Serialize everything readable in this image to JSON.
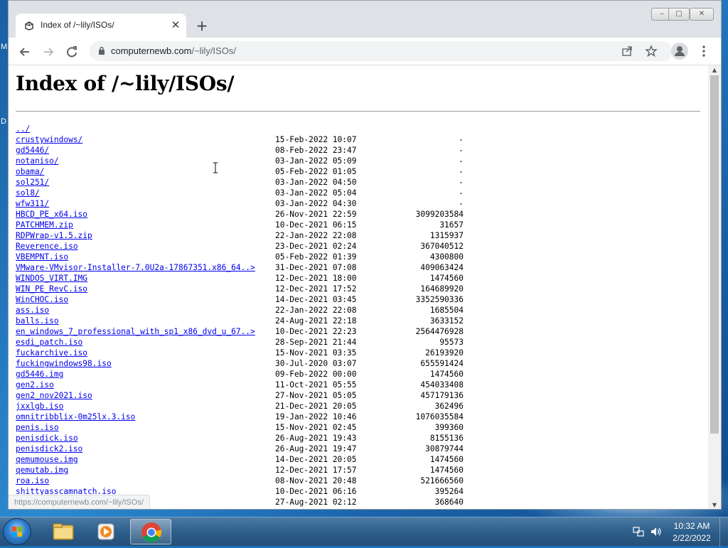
{
  "desktop": {
    "left_letters": [
      "M",
      "D"
    ]
  },
  "browser": {
    "tab": {
      "title": "Index of /~lily/ISOs/",
      "close_glyph": "✕"
    },
    "new_tab_glyph": "+",
    "window_controls": {
      "minimize": "‒",
      "maximize": "□",
      "close": "✕"
    },
    "address": {
      "host": "computernewb.com",
      "path": "/~lily/ISOs/"
    },
    "status_url": "https://computernewb.com/~lily/ISOs/"
  },
  "page": {
    "heading": "Index of /~lily/ISOs/",
    "entries": [
      {
        "name": "../",
        "date": "",
        "size": ""
      },
      {
        "name": "crustywindows/",
        "date": "15-Feb-2022 10:07",
        "size": "-"
      },
      {
        "name": "gd5446/",
        "date": "08-Feb-2022 23:47",
        "size": "-"
      },
      {
        "name": "notaniso/",
        "date": "03-Jan-2022 05:09",
        "size": "-"
      },
      {
        "name": "obama/",
        "date": "05-Feb-2022 01:05",
        "size": "-"
      },
      {
        "name": "sol251/",
        "date": "03-Jan-2022 04:50",
        "size": "-"
      },
      {
        "name": "sol8/",
        "date": "03-Jan-2022 05:04",
        "size": "-"
      },
      {
        "name": "wfw311/",
        "date": "03-Jan-2022 04:30",
        "size": "-"
      },
      {
        "name": "HBCD_PE_x64.iso",
        "date": "26-Nov-2021 22:59",
        "size": "3099203584"
      },
      {
        "name": "PATCHMEM.zip",
        "date": "10-Dec-2021 06:15",
        "size": "31657"
      },
      {
        "name": "RDPWrap-v1.5.zip",
        "date": "22-Jan-2022 22:08",
        "size": "1315937"
      },
      {
        "name": "Reverence.iso",
        "date": "23-Dec-2021 02:24",
        "size": "367040512"
      },
      {
        "name": "VBEMPNT.iso",
        "date": "05-Feb-2022 01:39",
        "size": "4300800"
      },
      {
        "name": "VMware-VMvisor-Installer-7.0U2a-17867351.x86_64..>",
        "date": "31-Dec-2021 07:08",
        "size": "409063424"
      },
      {
        "name": "WINDOS_VIRT.IMG",
        "date": "12-Dec-2021 18:00",
        "size": "1474560"
      },
      {
        "name": "WIN_PE_RevC.iso",
        "date": "12-Dec-2021 17:52",
        "size": "164689920"
      },
      {
        "name": "WinCHOC.iso",
        "date": "14-Dec-2021 03:45",
        "size": "3352590336"
      },
      {
        "name": "ass.iso",
        "date": "22-Jan-2022 22:08",
        "size": "1685504"
      },
      {
        "name": "balls.iso",
        "date": "24-Aug-2021 22:18",
        "size": "3633152"
      },
      {
        "name": "en_windows_7_professional_with_sp1_x86_dvd_u_67..>",
        "date": "10-Dec-2021 22:23",
        "size": "2564476928"
      },
      {
        "name": "esdi_patch.iso",
        "date": "28-Sep-2021 21:44",
        "size": "95573"
      },
      {
        "name": "fuckarchive.iso",
        "date": "15-Nov-2021 03:35",
        "size": "26193920"
      },
      {
        "name": "fuckingwindows98.iso",
        "date": "30-Jul-2020 03:07",
        "size": "655591424"
      },
      {
        "name": "gd5446.img",
        "date": "09-Feb-2022 00:00",
        "size": "1474560"
      },
      {
        "name": "gen2.iso",
        "date": "11-Oct-2021 05:55",
        "size": "454033408"
      },
      {
        "name": "gen2_nov2021.iso",
        "date": "27-Nov-2021 05:05",
        "size": "457179136"
      },
      {
        "name": "jxxlgb.iso",
        "date": "21-Dec-2021 20:05",
        "size": "362496"
      },
      {
        "name": "omnitribblix-0m25lx.3.iso",
        "date": "19-Jan-2022 10:46",
        "size": "1076035584"
      },
      {
        "name": "penis.iso",
        "date": "15-Nov-2021 02:45",
        "size": "399360"
      },
      {
        "name": "penisdick.iso",
        "date": "26-Aug-2021 19:43",
        "size": "8155136"
      },
      {
        "name": "penisdick2.iso",
        "date": "26-Aug-2021 19:47",
        "size": "30879744"
      },
      {
        "name": "qemumouse.img",
        "date": "14-Dec-2021 20:05",
        "size": "1474560"
      },
      {
        "name": "qemutab.img",
        "date": "12-Dec-2021 17:57",
        "size": "1474560"
      },
      {
        "name": "roa.iso",
        "date": "08-Nov-2021 20:48",
        "size": "521666560"
      },
      {
        "name": "shittyasscamnatch.iso",
        "date": "10-Dec-2021 06:16",
        "size": "395264"
      },
      {
        "name": "",
        "date": "27-Aug-2021 02:12",
        "size": "368640"
      }
    ]
  },
  "taskbar": {
    "clock_time": "10:32 AM",
    "clock_date": "2/22/2022",
    "apps": [
      "windows-explorer",
      "media-player",
      "chrome"
    ]
  },
  "colors": {
    "link": "#0000ee",
    "chrome_frame": "#dee1e6",
    "taskbar": "#2d5f8c"
  }
}
